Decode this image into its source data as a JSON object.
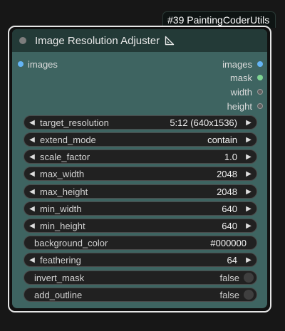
{
  "badge": "#39 PaintingCoderUtils",
  "node": {
    "title": "Image Resolution Adjuster",
    "inputs": [
      {
        "label": "images",
        "type": "image"
      }
    ],
    "outputs": [
      {
        "label": "images",
        "type": "image"
      },
      {
        "label": "mask",
        "type": "mask"
      },
      {
        "label": "width",
        "type": "int"
      },
      {
        "label": "height",
        "type": "int"
      }
    ],
    "widgets": {
      "target_resolution": {
        "label": "target_resolution",
        "value": "5:12 (640x1536)"
      },
      "extend_mode": {
        "label": "extend_mode",
        "value": "contain"
      },
      "scale_factor": {
        "label": "scale_factor",
        "value": "1.0"
      },
      "max_width": {
        "label": "max_width",
        "value": "2048"
      },
      "max_height": {
        "label": "max_height",
        "value": "2048"
      },
      "min_width": {
        "label": "min_width",
        "value": "640"
      },
      "min_height": {
        "label": "min_height",
        "value": "640"
      },
      "background_color": {
        "label": "background_color",
        "value": "#000000"
      },
      "feathering": {
        "label": "feathering",
        "value": "64"
      },
      "invert_mask": {
        "label": "invert_mask",
        "value": "false"
      },
      "add_outline": {
        "label": "add_outline",
        "value": "false"
      }
    }
  },
  "colors": {
    "node_body": "#3e6461",
    "node_title": "#233a37",
    "image_slot": "#64b5f6",
    "mask_slot": "#7ed492"
  }
}
